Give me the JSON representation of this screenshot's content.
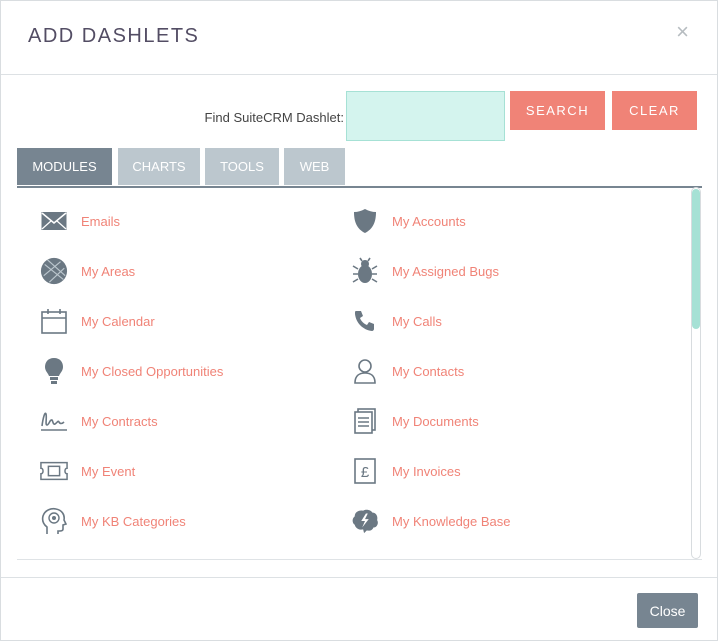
{
  "modal": {
    "title": "ADD DASHLETS",
    "close_glyph": "×"
  },
  "search": {
    "label": "Find SuiteCRM Dashlet:",
    "value": "",
    "search_button": "SEARCH",
    "clear_button": "CLEAR"
  },
  "tabs": [
    {
      "label": "MODULES",
      "active": true
    },
    {
      "label": "CHARTS",
      "active": false
    },
    {
      "label": "TOOLS",
      "active": false
    },
    {
      "label": "WEB",
      "active": false
    }
  ],
  "modules_left": [
    {
      "label": "Emails",
      "icon": "envelope-icon"
    },
    {
      "label": "My Areas",
      "icon": "areas-icon"
    },
    {
      "label": "My Calendar",
      "icon": "calendar-icon"
    },
    {
      "label": "My Closed Opportunities",
      "icon": "lightbulb-icon"
    },
    {
      "label": "My Contracts",
      "icon": "signature-icon"
    },
    {
      "label": "My Event",
      "icon": "ticket-icon"
    },
    {
      "label": "My KB Categories",
      "icon": "head-icon"
    }
  ],
  "modules_right": [
    {
      "label": "My Accounts",
      "icon": "shield-icon"
    },
    {
      "label": "My Assigned Bugs",
      "icon": "bug-icon"
    },
    {
      "label": "My Calls",
      "icon": "phone-icon"
    },
    {
      "label": "My Contacts",
      "icon": "person-icon"
    },
    {
      "label": "My Documents",
      "icon": "document-icon"
    },
    {
      "label": "My Invoices",
      "icon": "pound-invoice-icon"
    },
    {
      "label": "My Knowledge Base",
      "icon": "brain-icon"
    }
  ],
  "footer": {
    "close_button": "Close"
  },
  "colors": {
    "accent": "#f08377",
    "slate": "#778591",
    "mint": "#d4f4ee",
    "icon": "#6b7883"
  }
}
